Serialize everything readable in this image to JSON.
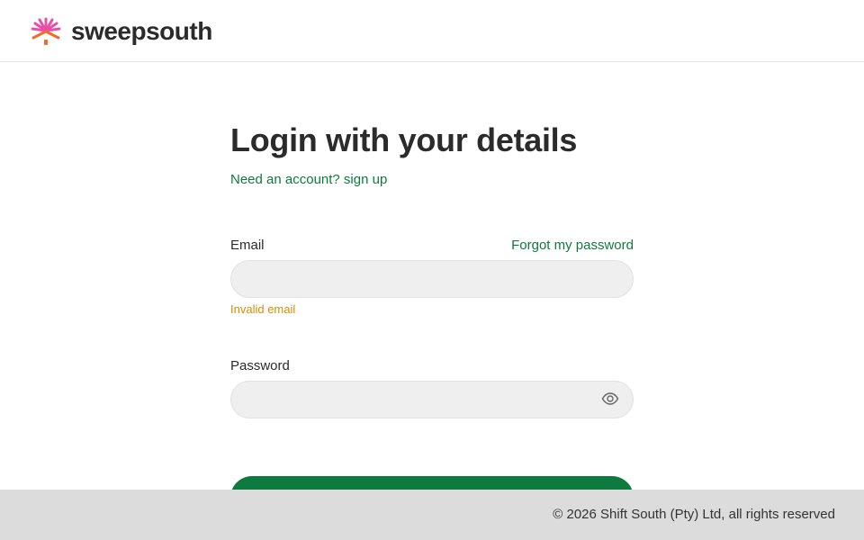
{
  "brand": {
    "name": "sweepsouth"
  },
  "colors": {
    "accent_green": "#0e7a3f",
    "error_orange": "#e08a00",
    "logo_pink": "#e84fa8",
    "logo_orange": "#f26b2a"
  },
  "login": {
    "title": "Login with your details",
    "signup_link": "Need an account? sign up",
    "email_label": "Email",
    "forgot_password": "Forgot my password",
    "email_value": "",
    "email_error": "Invalid email",
    "password_label": "Password",
    "password_value": "",
    "password_toggle_icon": "eye-icon"
  },
  "footer": {
    "copyright": "© 2026 Shift South (Pty) Ltd, all rights reserved"
  }
}
